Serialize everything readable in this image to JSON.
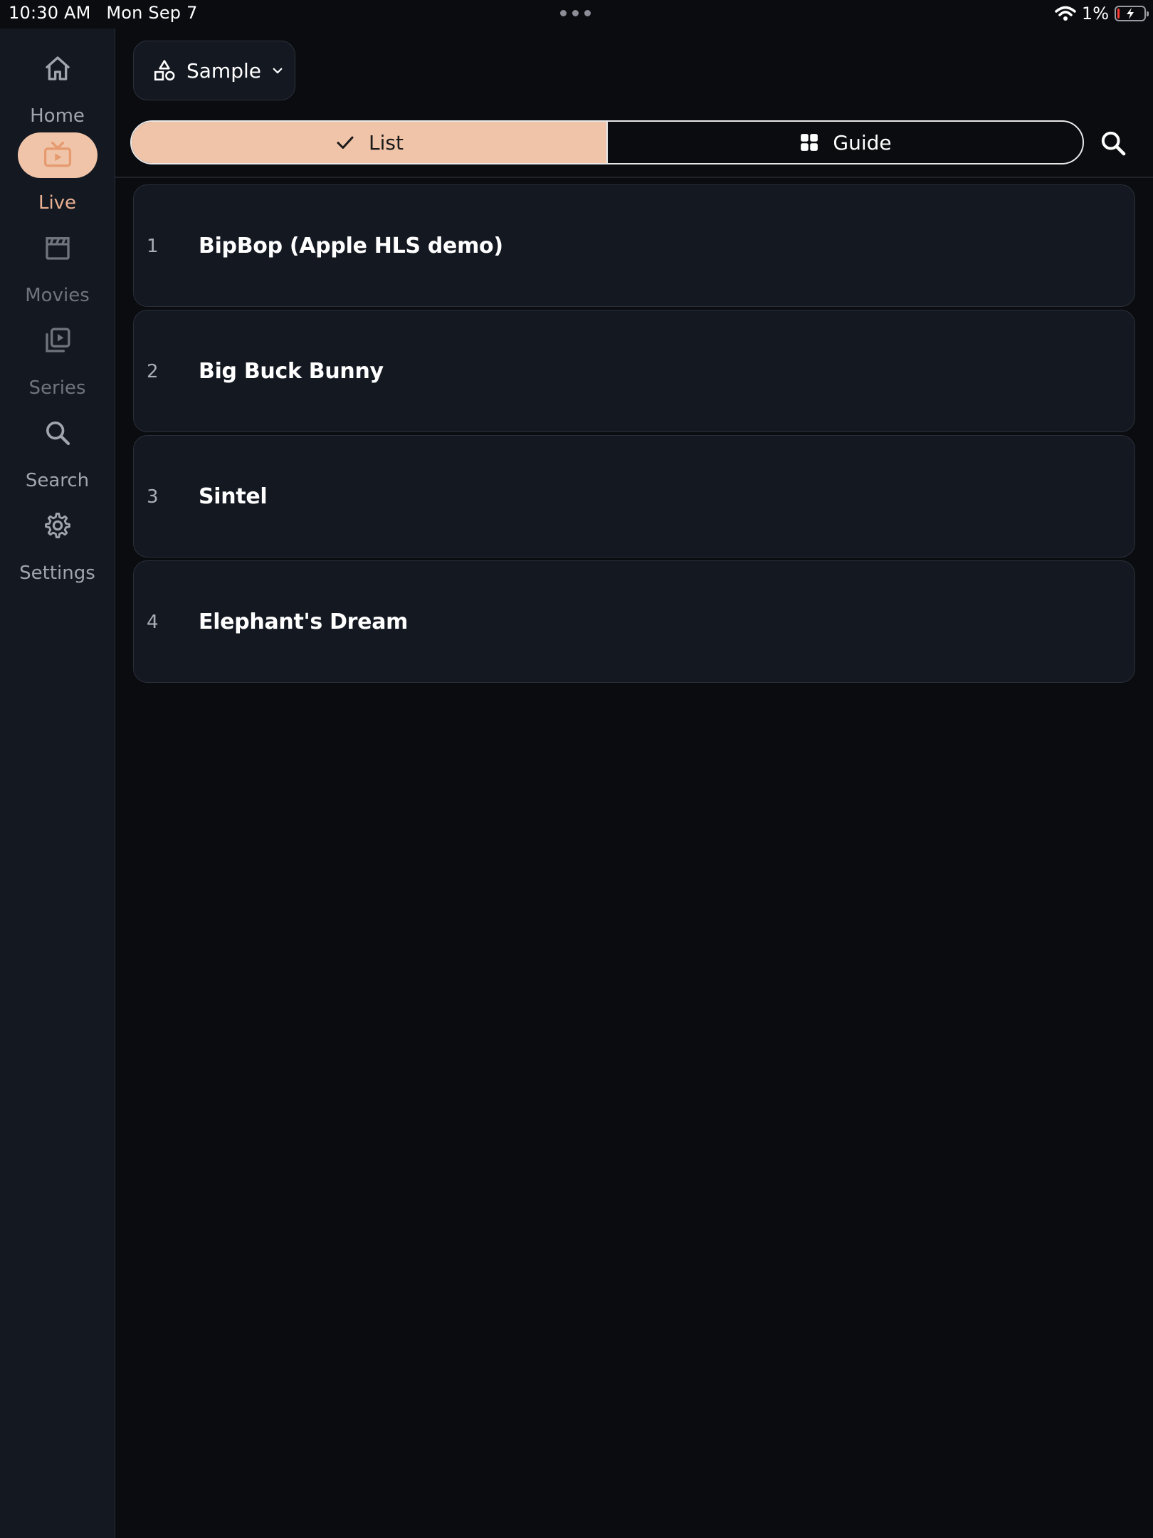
{
  "status_bar": {
    "time": "10:30 AM",
    "date": "Mon Sep 7",
    "battery_percent": "1%",
    "battery_level": 0.01
  },
  "sidebar": {
    "items": [
      {
        "label": "Home",
        "icon": "home-icon"
      },
      {
        "label": "Live",
        "icon": "tv-icon"
      },
      {
        "label": "Movies",
        "icon": "clapperboard-icon"
      },
      {
        "label": "Series",
        "icon": "play-stack-icon"
      },
      {
        "label": "Search",
        "icon": "search-icon"
      },
      {
        "label": "Settings",
        "icon": "gear-icon"
      }
    ],
    "active_index": 1,
    "active_color": "#f0c4a8"
  },
  "header": {
    "playlist_selector": {
      "label": "Sample",
      "icon": "shapes-icon"
    },
    "view_toggle": {
      "list_label": "List",
      "guide_label": "Guide",
      "selected": "List"
    }
  },
  "channels": [
    {
      "number": "1",
      "name": "BipBop (Apple HLS demo)"
    },
    {
      "number": "2",
      "name": "Big Buck Bunny"
    },
    {
      "number": "3",
      "name": "Sintel"
    },
    {
      "number": "4",
      "name": "Elephant's Dream"
    }
  ],
  "colors": {
    "background": "#0b0c10",
    "sidebar": "#141821",
    "accent": "#f0c4a8",
    "accent_text": "#eab193"
  }
}
